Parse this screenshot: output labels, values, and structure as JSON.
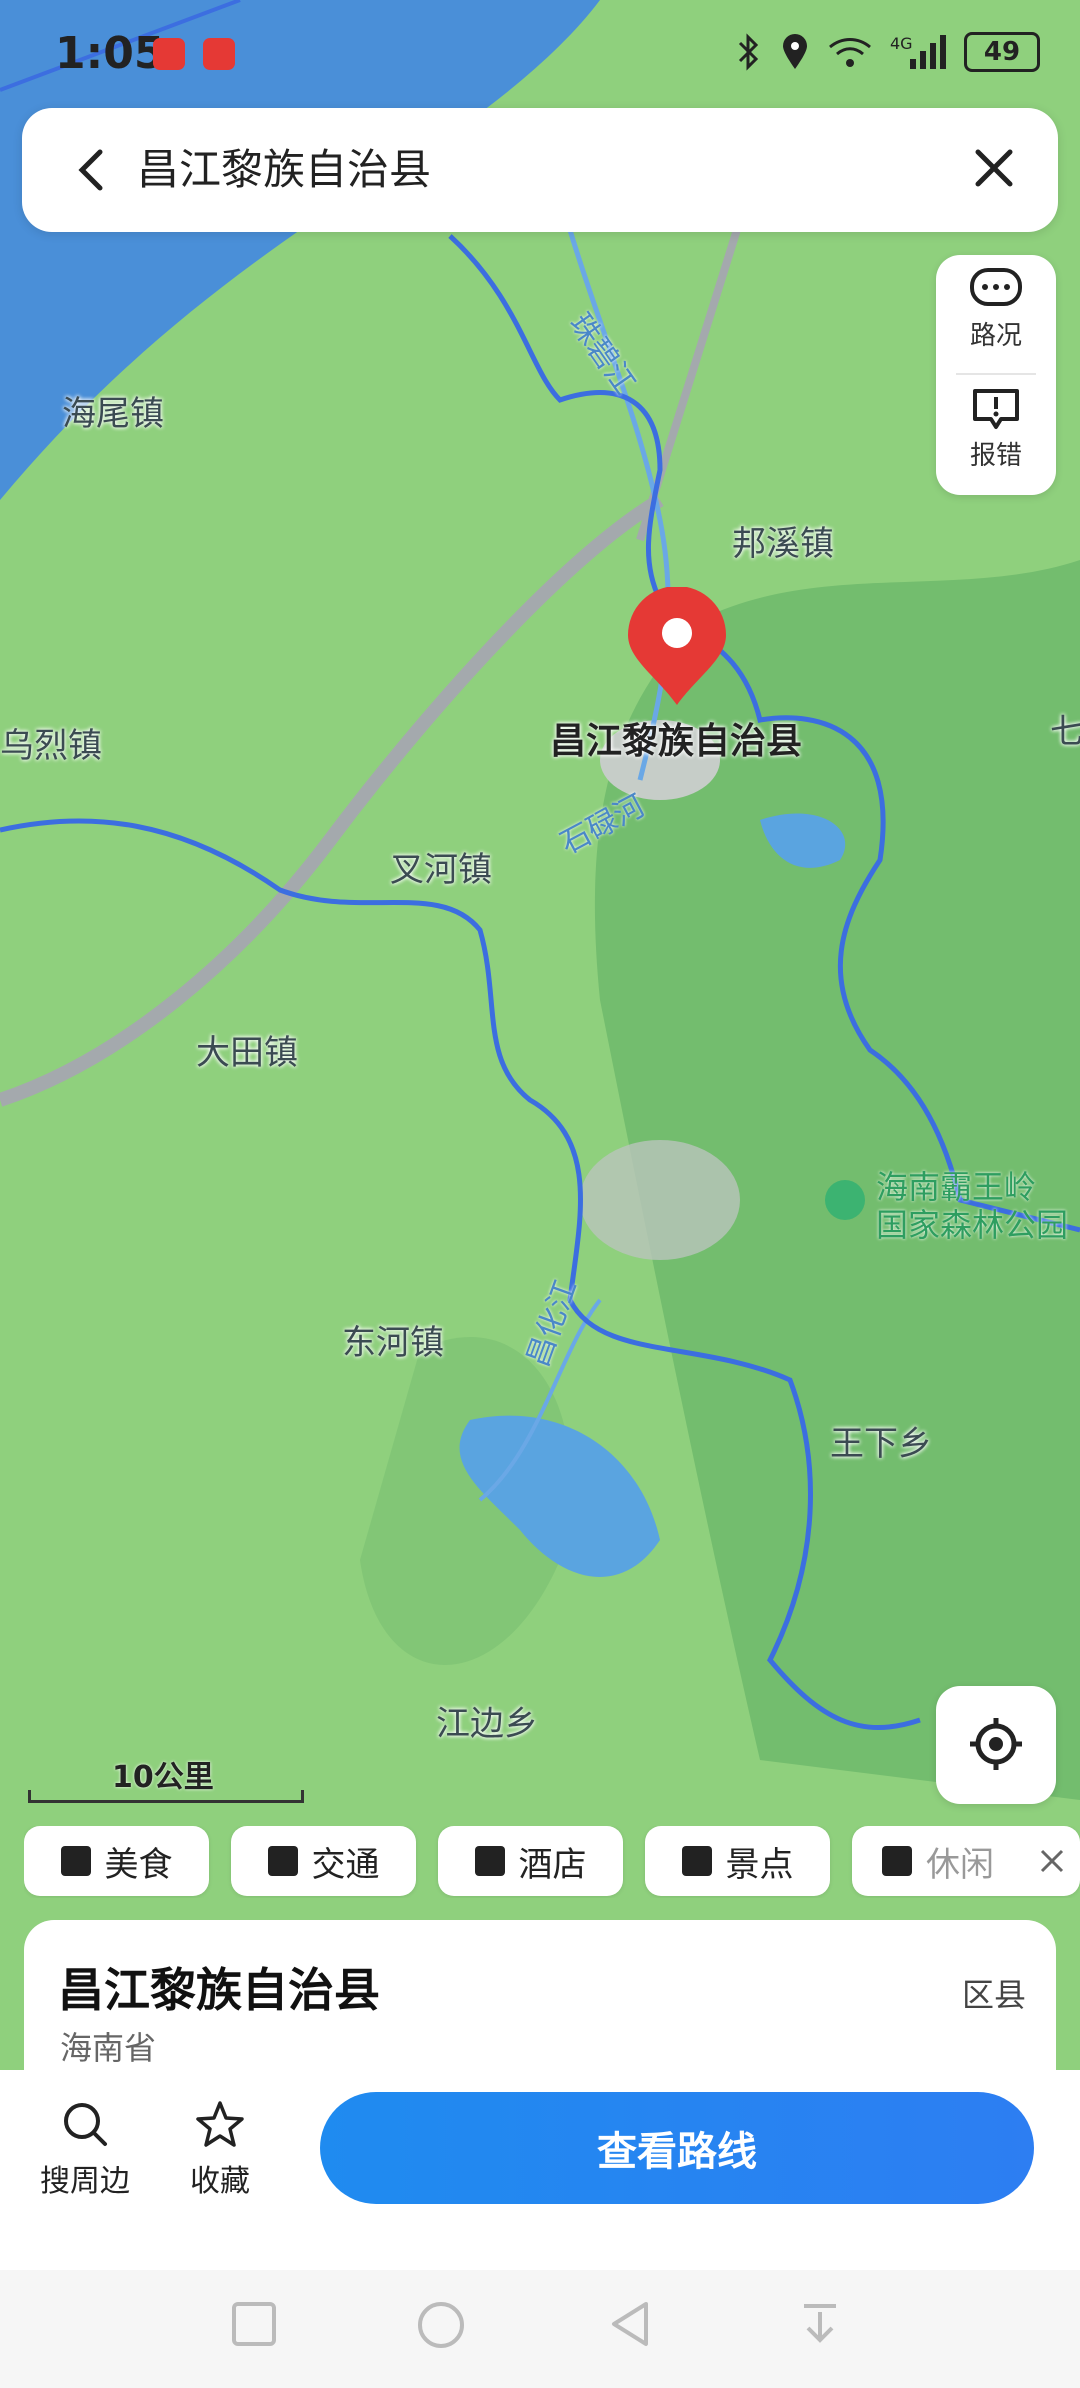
{
  "status": {
    "time": "1:05",
    "battery": "49",
    "network": "4G"
  },
  "search": {
    "query": "昌江黎族自治县"
  },
  "side_buttons": [
    {
      "label": "路况"
    },
    {
      "label": "报错"
    }
  ],
  "map_labels": {
    "haiwei": "海尾镇",
    "bangxi": "邦溪镇",
    "wulie": "乌烈镇",
    "chahe": "叉河镇",
    "datian": "大田镇",
    "donghe": "东河镇",
    "wangxia": "王下乡",
    "jiangbian": "江边乡",
    "edge_char": "七"
  },
  "rivers": {
    "zhubi": "珠碧江",
    "shilu": "石碌河",
    "changhua": "昌化江"
  },
  "poi": {
    "line1": "海南霸王岭",
    "line2": "国家森林公园"
  },
  "center_label": "昌江黎族自治县",
  "scale": {
    "text": "10公里"
  },
  "categories": [
    {
      "label": "美食",
      "icon": "utensils-icon"
    },
    {
      "label": "交通",
      "icon": "bus-icon"
    },
    {
      "label": "酒店",
      "icon": "hotel-icon"
    },
    {
      "label": "景点",
      "icon": "mountain-icon"
    },
    {
      "label": "休闲",
      "icon": "cocktail-icon"
    }
  ],
  "place": {
    "name": "昌江黎族自治县",
    "province": "海南省",
    "type": "区县"
  },
  "actions": {
    "nearby": "搜周边",
    "favorite": "收藏",
    "route": "查看路线"
  },
  "colors": {
    "accent": "#1f8bf0",
    "pin": "#e53935",
    "land": "#8fd07d",
    "sea": "#4a8fd8"
  }
}
